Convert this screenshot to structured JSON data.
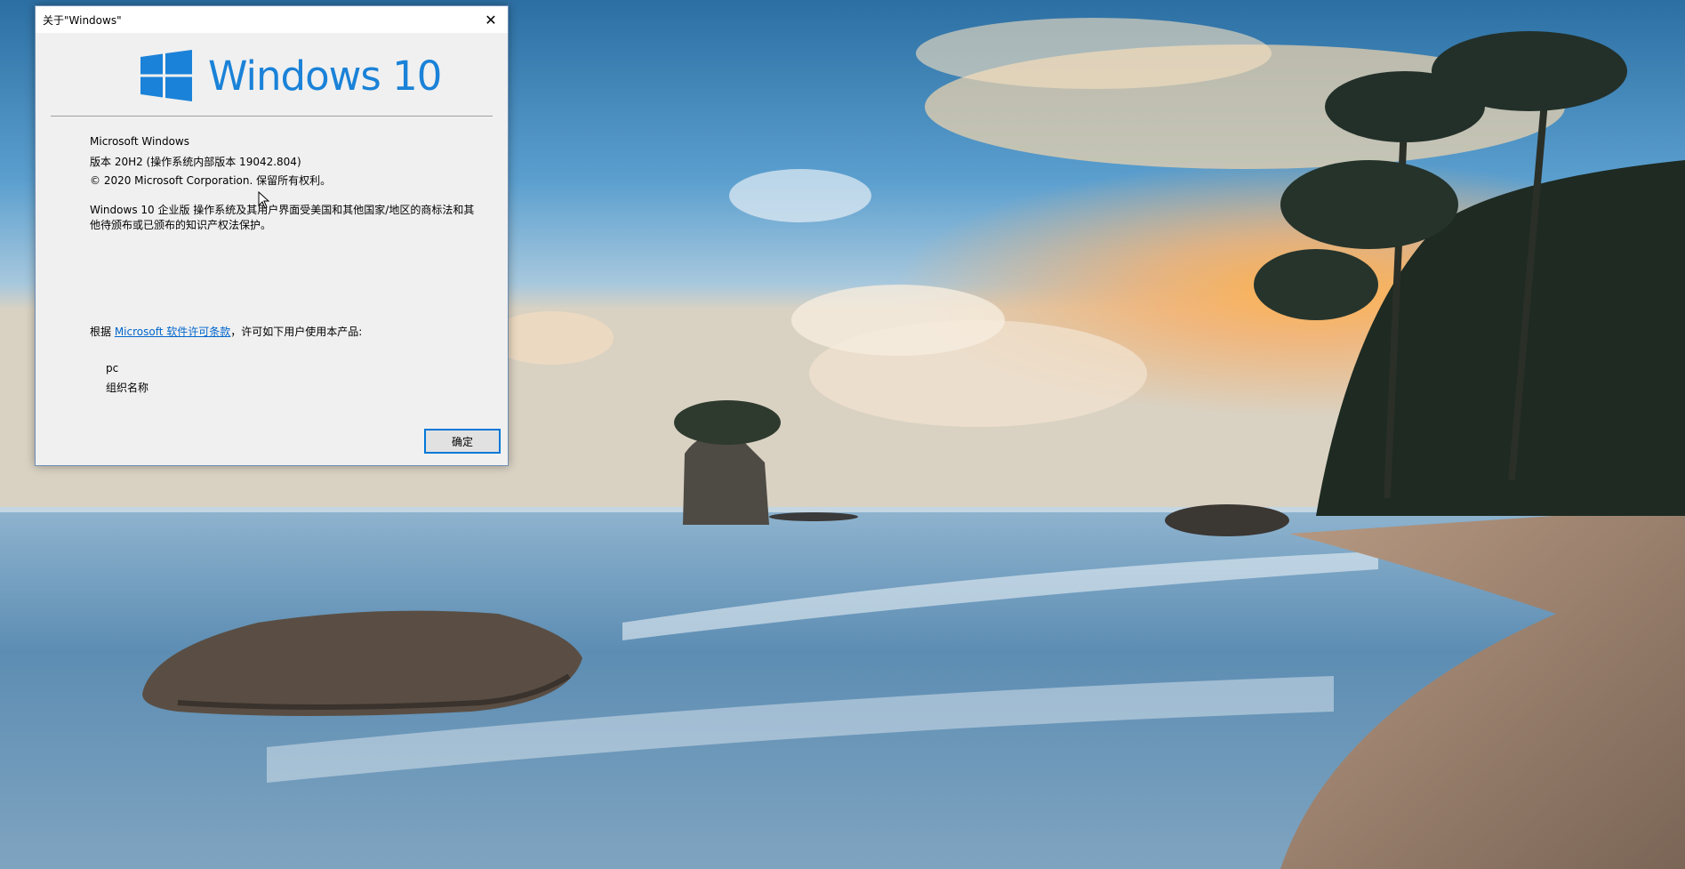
{
  "desktop": {
    "wallpaper_icon": "beach-sunset-wallpaper"
  },
  "dialog": {
    "title": "关于\"Windows\"",
    "close_label": "✕",
    "logo_text": "Windows 10",
    "product_name": "Microsoft Windows",
    "version": "版本 20H2 (操作系统内部版本 19042.804)",
    "copyright": "© 2020 Microsoft Corporation. 保留所有权利。",
    "description": "Windows 10 企业版 操作系统及其用户界面受美国和其他国家/地区的商标法和其他待颁布或已颁布的知识产权法保护。",
    "license_prefix": "根据 ",
    "license_link": "Microsoft 软件许可条款",
    "license_suffix": "，许可如下用户使用本产品:",
    "user_name": "pc",
    "organization": "组织名称",
    "ok_label": "确定"
  },
  "colors": {
    "windows_blue": "#1a82d8",
    "link": "#0066cc",
    "button_focus_border": "#0078d7"
  }
}
